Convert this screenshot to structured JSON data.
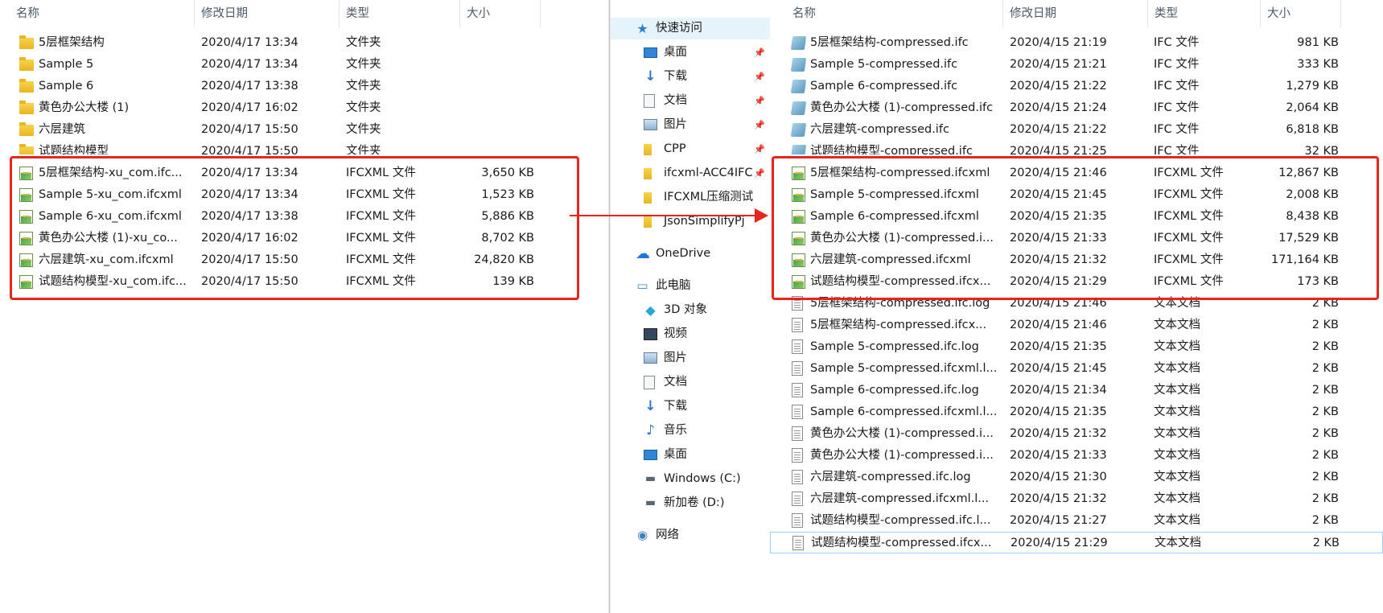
{
  "left": {
    "columns": {
      "name": "名称",
      "date": "修改日期",
      "type": "类型",
      "size": "大小"
    },
    "rows": [
      {
        "icon": "folder-icon",
        "name": "5层框架结构",
        "date": "2020/4/17 13:34",
        "type": "文件夹",
        "size": ""
      },
      {
        "icon": "folder-icon",
        "name": "Sample 5",
        "date": "2020/4/17 13:34",
        "type": "文件夹",
        "size": ""
      },
      {
        "icon": "folder-icon",
        "name": "Sample 6",
        "date": "2020/4/17 13:38",
        "type": "文件夹",
        "size": ""
      },
      {
        "icon": "folder-icon",
        "name": "黄色办公大楼 (1)",
        "date": "2020/4/17 16:02",
        "type": "文件夹",
        "size": ""
      },
      {
        "icon": "folder-icon",
        "name": "六层建筑",
        "date": "2020/4/17 15:50",
        "type": "文件夹",
        "size": ""
      },
      {
        "icon": "folder-icon",
        "name": "试题结构模型",
        "date": "2020/4/17 15:50",
        "type": "文件夹",
        "size": ""
      },
      {
        "icon": "ifcxml-file-icon",
        "name": "5层框架结构-xu_com.ifc...",
        "date": "2020/4/17 13:34",
        "type": "IFCXML 文件",
        "size": "3,650 KB"
      },
      {
        "icon": "ifcxml-file-icon",
        "name": "Sample 5-xu_com.ifcxml",
        "date": "2020/4/17 13:34",
        "type": "IFCXML 文件",
        "size": "1,523 KB"
      },
      {
        "icon": "ifcxml-file-icon",
        "name": "Sample 6-xu_com.ifcxml",
        "date": "2020/4/17 13:38",
        "type": "IFCXML 文件",
        "size": "5,886 KB"
      },
      {
        "icon": "ifcxml-file-icon",
        "name": "黄色办公大楼 (1)-xu_co...",
        "date": "2020/4/17 16:02",
        "type": "IFCXML 文件",
        "size": "8,702 KB"
      },
      {
        "icon": "ifcxml-file-icon",
        "name": "六层建筑-xu_com.ifcxml",
        "date": "2020/4/17 15:50",
        "type": "IFCXML 文件",
        "size": "24,820 KB"
      },
      {
        "icon": "ifcxml-file-icon",
        "name": "试题结构模型-xu_com.ifc...",
        "date": "2020/4/17 15:50",
        "type": "IFCXML 文件",
        "size": "139 KB"
      }
    ]
  },
  "nav": {
    "items": [
      {
        "icon": "star-icon",
        "label": "快速访问",
        "pinned": false,
        "level": 1
      },
      {
        "icon": "desktop-icon",
        "label": "桌面",
        "pinned": true,
        "level": 2
      },
      {
        "icon": "download-icon",
        "label": "下载",
        "pinned": true,
        "level": 2
      },
      {
        "icon": "documents-icon",
        "label": "文档",
        "pinned": true,
        "level": 2
      },
      {
        "icon": "pictures-icon",
        "label": "图片",
        "pinned": true,
        "level": 2
      },
      {
        "icon": "folder-icon",
        "label": "CPP",
        "pinned": true,
        "level": 2
      },
      {
        "icon": "folder-icon",
        "label": "ifcxml-ACC4IFC",
        "pinned": true,
        "level": 2
      },
      {
        "icon": "folder-icon",
        "label": "IFCXML压缩测试",
        "pinned": false,
        "level": 2
      },
      {
        "icon": "folder-icon",
        "label": "JsonSimplifyPj",
        "pinned": false,
        "level": 2
      },
      {
        "icon": "onedrive-icon",
        "label": "OneDrive",
        "pinned": false,
        "level": 1
      },
      {
        "icon": "this-pc-icon",
        "label": "此电脑",
        "pinned": false,
        "level": 1
      },
      {
        "icon": "3d-objects-icon",
        "label": "3D 对象",
        "pinned": false,
        "level": 2
      },
      {
        "icon": "videos-icon",
        "label": "视频",
        "pinned": false,
        "level": 2
      },
      {
        "icon": "pictures-icon",
        "label": "图片",
        "pinned": false,
        "level": 2
      },
      {
        "icon": "documents-icon",
        "label": "文档",
        "pinned": false,
        "level": 2
      },
      {
        "icon": "download-icon",
        "label": "下载",
        "pinned": false,
        "level": 2
      },
      {
        "icon": "music-icon",
        "label": "音乐",
        "pinned": false,
        "level": 2
      },
      {
        "icon": "desktop-icon",
        "label": "桌面",
        "pinned": false,
        "level": 2
      },
      {
        "icon": "windows-drive-icon",
        "label": "Windows (C:)",
        "pinned": false,
        "level": 2
      },
      {
        "icon": "drive-icon",
        "label": "新加卷 (D:)",
        "pinned": false,
        "level": 2
      },
      {
        "icon": "network-icon",
        "label": "网络",
        "pinned": false,
        "level": 1
      }
    ]
  },
  "right": {
    "columns": {
      "name": "名称",
      "date": "修改日期",
      "type": "类型",
      "size": "大小"
    },
    "rows": [
      {
        "icon": "ifc-file-icon",
        "name": "5层框架结构-compressed.ifc",
        "date": "2020/4/15 21:19",
        "type": "IFC 文件",
        "size": "981 KB"
      },
      {
        "icon": "ifc-file-icon",
        "name": "Sample 5-compressed.ifc",
        "date": "2020/4/15 21:21",
        "type": "IFC 文件",
        "size": "333 KB"
      },
      {
        "icon": "ifc-file-icon",
        "name": "Sample 6-compressed.ifc",
        "date": "2020/4/15 21:22",
        "type": "IFC 文件",
        "size": "1,279 KB"
      },
      {
        "icon": "ifc-file-icon",
        "name": "黄色办公大楼 (1)-compressed.ifc",
        "date": "2020/4/15 21:24",
        "type": "IFC 文件",
        "size": "2,064 KB"
      },
      {
        "icon": "ifc-file-icon",
        "name": "六层建筑-compressed.ifc",
        "date": "2020/4/15 21:22",
        "type": "IFC 文件",
        "size": "6,818 KB"
      },
      {
        "icon": "ifc-file-icon",
        "name": "试题结构模型-compressed.ifc",
        "date": "2020/4/15 21:25",
        "type": "IFC 文件",
        "size": "32 KB"
      },
      {
        "icon": "ifcxml-file-icon",
        "name": "5层框架结构-compressed.ifcxml",
        "date": "2020/4/15 21:46",
        "type": "IFCXML 文件",
        "size": "12,867 KB"
      },
      {
        "icon": "ifcxml-file-icon",
        "name": "Sample 5-compressed.ifcxml",
        "date": "2020/4/15 21:45",
        "type": "IFCXML 文件",
        "size": "2,008 KB"
      },
      {
        "icon": "ifcxml-file-icon",
        "name": "Sample 6-compressed.ifcxml",
        "date": "2020/4/15 21:35",
        "type": "IFCXML 文件",
        "size": "8,438 KB"
      },
      {
        "icon": "ifcxml-file-icon",
        "name": "黄色办公大楼 (1)-compressed.i...",
        "date": "2020/4/15 21:33",
        "type": "IFCXML 文件",
        "size": "17,529 KB"
      },
      {
        "icon": "ifcxml-file-icon",
        "name": "六层建筑-compressed.ifcxml",
        "date": "2020/4/15 21:32",
        "type": "IFCXML 文件",
        "size": "171,164 KB"
      },
      {
        "icon": "ifcxml-file-icon",
        "name": "试题结构模型-compressed.ifcx...",
        "date": "2020/4/15 21:29",
        "type": "IFCXML 文件",
        "size": "173 KB"
      },
      {
        "icon": "text-file-icon",
        "name": "5层框架结构-compressed.ifc.log",
        "date": "2020/4/15 21:46",
        "type": "文本文档",
        "size": "2 KB"
      },
      {
        "icon": "text-file-icon",
        "name": "5层框架结构-compressed.ifcx...",
        "date": "2020/4/15 21:46",
        "type": "文本文档",
        "size": "2 KB"
      },
      {
        "icon": "text-file-icon",
        "name": "Sample 5-compressed.ifc.log",
        "date": "2020/4/15 21:35",
        "type": "文本文档",
        "size": "2 KB"
      },
      {
        "icon": "text-file-icon",
        "name": "Sample 5-compressed.ifcxml.l...",
        "date": "2020/4/15 21:45",
        "type": "文本文档",
        "size": "2 KB"
      },
      {
        "icon": "text-file-icon",
        "name": "Sample 6-compressed.ifc.log",
        "date": "2020/4/15 21:34",
        "type": "文本文档",
        "size": "2 KB"
      },
      {
        "icon": "text-file-icon",
        "name": "Sample 6-compressed.ifcxml.l...",
        "date": "2020/4/15 21:35",
        "type": "文本文档",
        "size": "2 KB"
      },
      {
        "icon": "text-file-icon",
        "name": "黄色办公大楼 (1)-compressed.i...",
        "date": "2020/4/15 21:32",
        "type": "文本文档",
        "size": "2 KB"
      },
      {
        "icon": "text-file-icon",
        "name": "黄色办公大楼 (1)-compressed.i...",
        "date": "2020/4/15 21:33",
        "type": "文本文档",
        "size": "2 KB"
      },
      {
        "icon": "text-file-icon",
        "name": "六层建筑-compressed.ifc.log",
        "date": "2020/4/15 21:30",
        "type": "文本文档",
        "size": "2 KB"
      },
      {
        "icon": "text-file-icon",
        "name": "六层建筑-compressed.ifcxml.l...",
        "date": "2020/4/15 21:32",
        "type": "文本文档",
        "size": "2 KB"
      },
      {
        "icon": "text-file-icon",
        "name": "试题结构模型-compressed.ifc.l...",
        "date": "2020/4/15 21:27",
        "type": "文本文档",
        "size": "2 KB"
      },
      {
        "icon": "text-file-icon",
        "name": "试题结构模型-compressed.ifcx...",
        "date": "2020/4/15 21:29",
        "type": "文本文档",
        "size": "2 KB"
      }
    ]
  },
  "colors": {
    "highlight": "#e8251d",
    "nav_selected": "#e5f3fb",
    "focus": "#99d1ff"
  }
}
